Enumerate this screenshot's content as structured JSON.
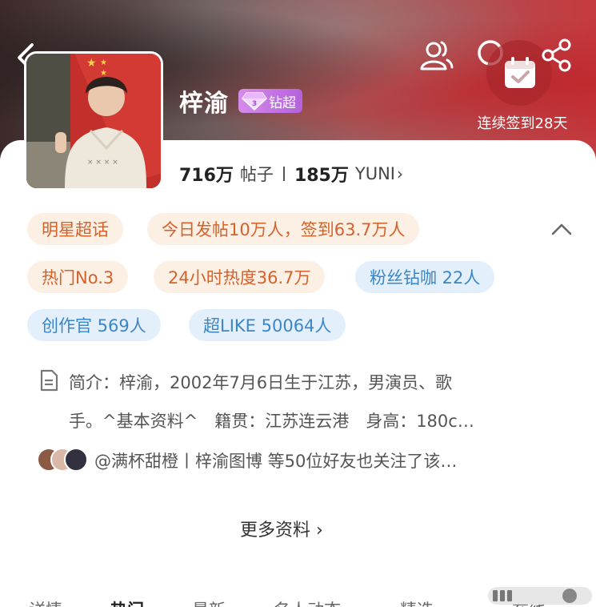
{
  "header": {
    "checkin_text": "连续签到28天"
  },
  "profile": {
    "title": "梓渝",
    "super_badge": "钻超",
    "posts_count": "716万",
    "posts_label": "帖子",
    "fans_count": "185万",
    "fans_label": "YUNI",
    "fans_arrow": "›"
  },
  "tags": [
    {
      "label": "明星超话",
      "style": "orange"
    },
    {
      "label": "今日发帖10万人，签到63.7万人",
      "style": "orange"
    },
    {
      "label": "热门No.3",
      "style": "orange"
    },
    {
      "label": "24小时热度36.7万",
      "style": "orange"
    },
    {
      "label": "粉丝钻咖 22人",
      "style": "blue"
    },
    {
      "label": "创作官 569人",
      "style": "blue"
    },
    {
      "label": "超LIKE 50064人",
      "style": "blue"
    }
  ],
  "intro": {
    "line1": "简介：梓渝，2002年7月6日生于江苏，男演员、歌",
    "line2": "手。^基本资料^　籍贯：江苏连云港　身高：180c…"
  },
  "friends": {
    "text": "@满杯甜橙丨梓渝图博 等50位好友也关注了该…"
  },
  "more_info": "更多资料 ›",
  "tabs": [
    {
      "label": "详情"
    },
    {
      "label": "热门",
      "active": true
    },
    {
      "label": "最新"
    },
    {
      "label": "名人动态"
    },
    {
      "label": "精选"
    },
    {
      "label": "在线"
    }
  ],
  "colors": {
    "accent_red": "#c53a3f",
    "tag_orange_text": "#d4622a",
    "tag_orange_bg": "#fcefe3",
    "tag_blue_text": "#3a86c8",
    "tag_blue_bg": "#e3f0fb",
    "badge_purple": "#b462dc"
  },
  "icons": [
    "back-arrow-icon",
    "user-group-icon",
    "search-icon",
    "share-icon",
    "calendar-check-icon",
    "diamond-icon",
    "document-icon",
    "chevron-up-icon"
  ]
}
